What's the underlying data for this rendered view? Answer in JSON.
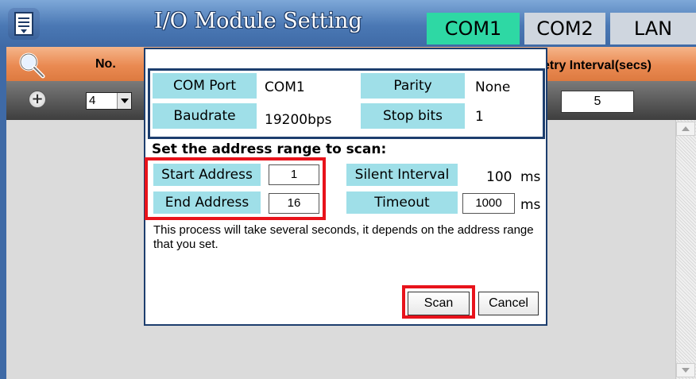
{
  "header": {
    "title": "I/O Module Setting",
    "tabs": [
      {
        "label": "COM1",
        "active": true
      },
      {
        "label": "COM2",
        "active": false
      },
      {
        "label": "LAN",
        "active": false
      }
    ]
  },
  "table": {
    "col_no": "No.",
    "col_retry_partial": "etry Interval(secs)",
    "row": {
      "no_value": "4",
      "retry_value": "5"
    }
  },
  "dialog": {
    "com_port_label": "COM Port",
    "com_port_value": "COM1",
    "parity_label": "Parity",
    "parity_value": "None",
    "baudrate_label": "Baudrate",
    "baudrate_value": "19200bps",
    "stop_bits_label": "Stop bits",
    "stop_bits_value": "1",
    "heading": "Set the address range to scan:",
    "start_address_label": "Start Address",
    "start_address_value": "1",
    "end_address_label": "End Address",
    "end_address_value": "16",
    "silent_interval_label": "Silent Interval",
    "silent_interval_value": "100",
    "silent_interval_unit": "ms",
    "timeout_label": "Timeout",
    "timeout_value": "1000",
    "timeout_unit": "ms",
    "note": "This process will take several seconds, it depends on the address range that you set.",
    "scan_label": "Scan",
    "cancel_label": "Cancel"
  },
  "colors": {
    "title_bar": "#4a78b4",
    "active_tab": "#2ed8a4",
    "header_row": "#ea8a52",
    "label_cell": "#9fdfe8",
    "highlight": "#e8131b"
  }
}
